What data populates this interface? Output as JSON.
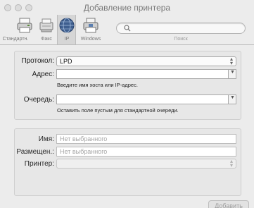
{
  "window": {
    "title": "Добавление принтера"
  },
  "toolbar": {
    "items": [
      {
        "label": "Стандартн.",
        "icon": "default-printer-icon"
      },
      {
        "label": "Факс",
        "icon": "fax-icon"
      },
      {
        "label": "IP",
        "icon": "ip-globe-icon",
        "selected": true
      },
      {
        "label": "Windows",
        "icon": "windows-printer-icon"
      }
    ],
    "search": {
      "placeholder": "",
      "caption": "Поиск"
    }
  },
  "form": {
    "protocol_label": "Протокол:",
    "protocol_value": "LPD",
    "address_label": "Адрес:",
    "address_value": "",
    "address_hint": "Введите имя хоста или IP-адрес.",
    "queue_label": "Очередь:",
    "queue_value": "",
    "queue_hint": "Оставить поле пустым для стандартной очереди."
  },
  "details": {
    "name_label": "Имя:",
    "name_placeholder": "Нет выбранного",
    "location_label": "Размещен.:",
    "location_placeholder": "Нет выбранного",
    "printer_label": "Принтер:",
    "printer_value": ""
  },
  "footer": {
    "add_button": "Добавить"
  },
  "colors": {
    "window_bg": "#ececec",
    "panel_bg": "#e7e7e7",
    "selected_tab": "#d6d6d6"
  }
}
